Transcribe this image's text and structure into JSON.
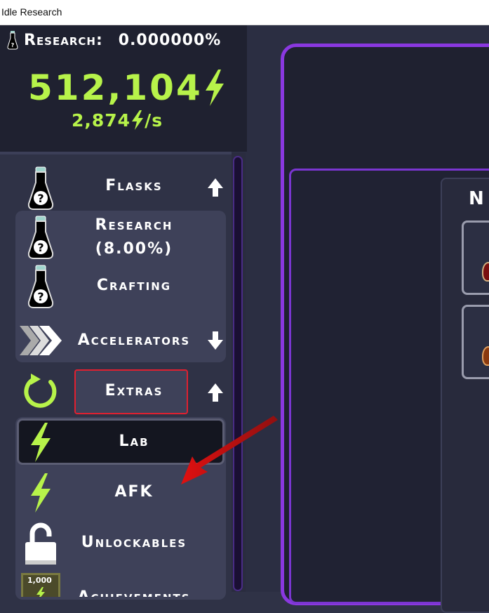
{
  "window": {
    "title": "Idle Research"
  },
  "stats": {
    "research_label": "Research:",
    "research_value": "0.000000%",
    "energy": "512,104",
    "rate_value": "2,874",
    "rate_unit": "/s",
    "accent_color": "#b7f34a"
  },
  "sidebar": {
    "items": [
      {
        "label": "Flasks",
        "icon": "flask-icon",
        "arrow": "up"
      },
      {
        "label": "Research",
        "sublabel": "(8.00%)",
        "icon": "flask-icon"
      },
      {
        "label": "Crafting",
        "icon": "flask-icon"
      },
      {
        "label": "Accelerators",
        "icon": "chevrons-icon",
        "arrow": "down"
      },
      {
        "label": "Extras",
        "icon": "refresh-icon",
        "arrow": "up"
      },
      {
        "label": "Lab",
        "icon": "lightning-icon",
        "selected": true
      },
      {
        "label": "AFK",
        "icon": "lightning-icon"
      },
      {
        "label": "Unlockables",
        "icon": "lock-icon"
      },
      {
        "label": "Achievements",
        "icon": "badge-icon",
        "badge": "1,000"
      }
    ]
  },
  "main": {
    "panel_title_partial": "N"
  },
  "highlight_color": "#e02030",
  "panel_border_color": "#8a38e0"
}
